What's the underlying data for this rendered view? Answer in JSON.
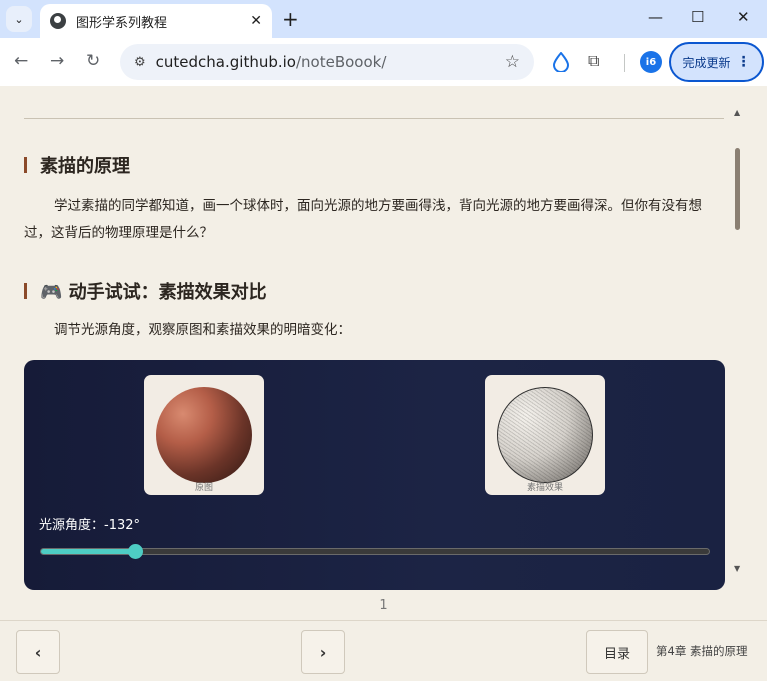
{
  "browser": {
    "tab_title": "图形学系列教程",
    "url_host": "cutedcha.github.io",
    "url_path": "/noteBoook/",
    "update_label": "完成更新",
    "ext_badge": "i6"
  },
  "article": {
    "section1_title": "素描的原理",
    "section1_text": "学过素描的同学都知道，画一个球体时，面向光源的地方要画得浅，背向光源的地方要画得深。但你有没有想过，这背后的物理原理是什么？",
    "section2_title": "🎮 动手试试：素描效果对比",
    "section2_text": "调节光源角度，观察原图和素描效果的明暗变化："
  },
  "demo": {
    "original_caption": "原图",
    "sketch_caption": "素描效果",
    "light_angle_label": "光源角度：-132°",
    "light_angle_deg": -132,
    "slider_value_fraction": 0.14,
    "accent_color": "#4ecdc4"
  },
  "footer": {
    "page_number": "1",
    "prev_label": "‹",
    "next_label": "›",
    "toc_label": "目录",
    "chapter_label": "第4章 素描的原理"
  }
}
